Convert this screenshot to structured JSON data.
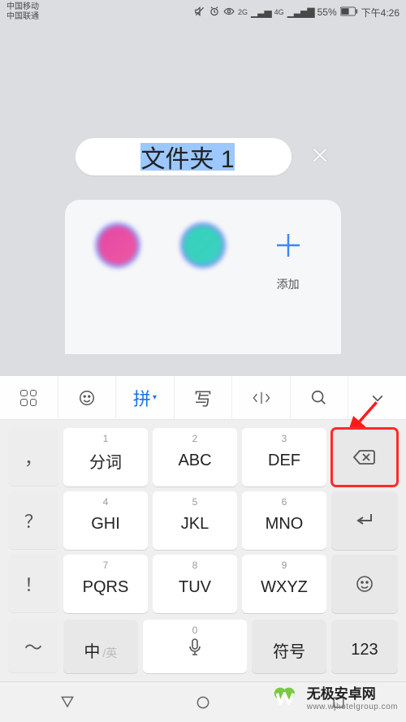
{
  "status": {
    "carrier1": "中国移动",
    "carrier2": "中国联通",
    "battery": "55%",
    "time": "下午4:26",
    "net1": "2G",
    "net2": "4G"
  },
  "folder": {
    "name_value": "文件夹 1",
    "apps": [
      {
        "label": "",
        "style": "pink"
      },
      {
        "label": "",
        "style": "teal"
      }
    ],
    "add_label": "添加"
  },
  "keyboard": {
    "toolbar": {
      "pinyin": "拼",
      "handwrite": "写"
    },
    "side": {
      "comma": "，",
      "question": "？",
      "exclaim": "！",
      "tilde": "～"
    },
    "keys": {
      "r1c1_num": "1",
      "r1c1": "分词",
      "r1c2_num": "2",
      "r1c2": "ABC",
      "r1c3_num": "3",
      "r1c3": "DEF",
      "r2c1_num": "4",
      "r2c1": "GHI",
      "r2c2_num": "5",
      "r2c2": "JKL",
      "r2c3_num": "6",
      "r2c3": "MNO",
      "r3c1_num": "7",
      "r3c1": "PQRS",
      "r3c2_num": "8",
      "r3c2": "TUV",
      "r3c3_num": "9",
      "r3c3": "WXYZ",
      "cn": "中",
      "en": "/英",
      "mic_num": "0",
      "symbol": "符号",
      "num123": "123"
    }
  },
  "watermark": {
    "big": "无极安卓网",
    "small": "www.wjhotelgroup.com"
  }
}
